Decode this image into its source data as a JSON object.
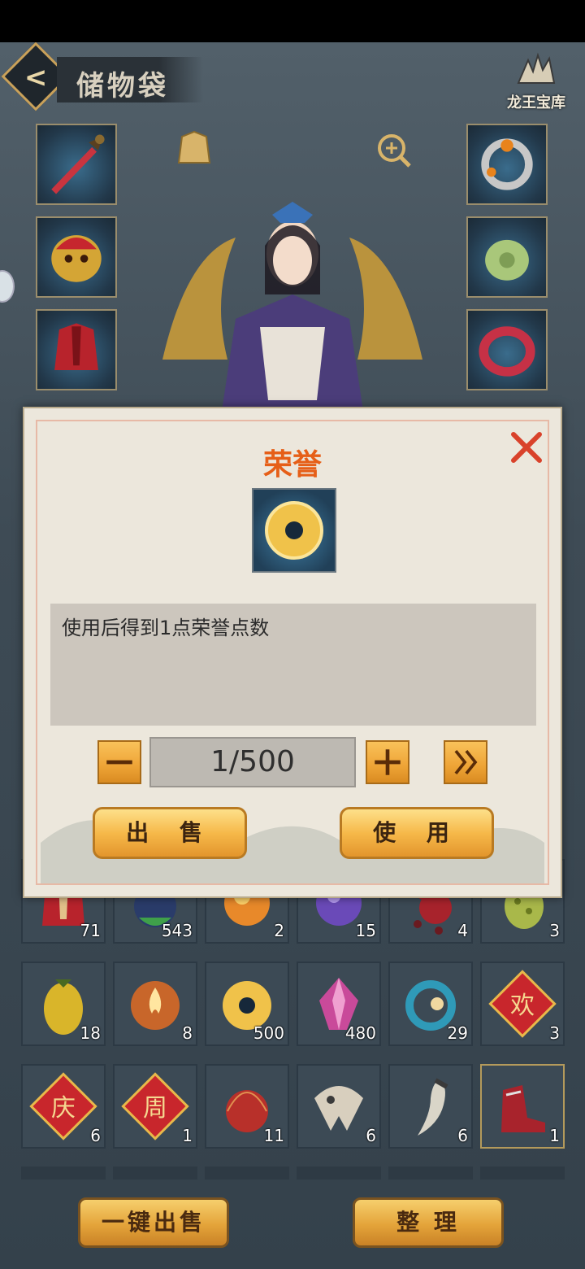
{
  "header": {
    "back_icon": "chevron-left-icon",
    "title": "储物袋",
    "treasury_label": "龙王宝库"
  },
  "equipment": {
    "left_slots": [
      "sword-icon",
      "lion-helmet-icon",
      "red-armor-icon"
    ],
    "right_slots": [
      "ring-icon",
      "jade-pendant-icon",
      "red-bracelet-icon"
    ],
    "wardrobe_icon": "robe-icon",
    "zoom_icon": "zoom-in-icon"
  },
  "inventory": {
    "rows": [
      [
        {
          "icon": "red-armor-icon",
          "count": "71"
        },
        {
          "icon": "potion-icon",
          "count": "543"
        },
        {
          "icon": "orange-orb-icon",
          "count": "2"
        },
        {
          "icon": "purple-orb-icon",
          "count": "15"
        },
        {
          "icon": "red-gourd-icon",
          "count": "4"
        },
        {
          "icon": "green-fruit-icon",
          "count": "3"
        }
      ],
      [
        {
          "icon": "yellow-fruit-icon",
          "count": "18"
        },
        {
          "icon": "fire-orb-icon",
          "count": "8"
        },
        {
          "icon": "golden-disc-icon",
          "count": "500"
        },
        {
          "icon": "pink-crystal-icon",
          "count": "480"
        },
        {
          "icon": "blue-ring-icon",
          "count": "29"
        },
        {
          "icon": "huan-card-icon",
          "count": "3",
          "char": "欢"
        }
      ],
      [
        {
          "icon": "qing-card-icon",
          "count": "6",
          "char": "庆"
        },
        {
          "icon": "zhou-card-icon",
          "count": "1",
          "char": "周"
        },
        {
          "icon": "red-fruit-icon",
          "count": "11"
        },
        {
          "icon": "skull-icon",
          "count": "6"
        },
        {
          "icon": "fang-icon",
          "count": "6"
        },
        {
          "icon": "red-boots-icon",
          "count": "1"
        }
      ]
    ]
  },
  "bottom": {
    "sell_all": "一键出售",
    "sort": "整 理"
  },
  "dialog": {
    "title": "荣誉",
    "item_icon": "golden-disc-icon",
    "description": "使用后得到1点荣誉点数",
    "quantity": "1/500",
    "minus_icon": "minus-icon",
    "plus_icon": "plus-icon",
    "max_icon": "double-chevron-right-icon",
    "sell": "出 售",
    "use": "使 用",
    "close_icon": "close-icon"
  },
  "colors": {
    "title_orange": "#e65f18",
    "button_gold": "#f6b94a",
    "dialog_bg": "#ece7dc"
  }
}
